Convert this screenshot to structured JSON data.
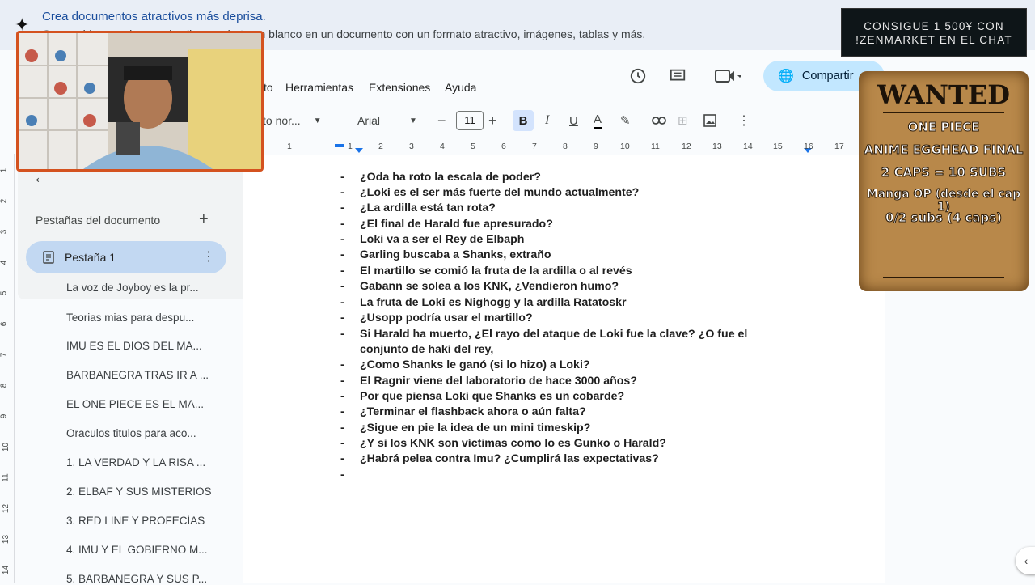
{
  "banner": {
    "title": "Crea documentos atractivos más deprisa.",
    "description": "Genera bloques de un solo clic: convierte en blanco en un documento con un formato atractivo, imágenes, tablas y más."
  },
  "menu": {
    "items": [
      "to",
      "Herramientas",
      "Extensiones",
      "Ayuda"
    ]
  },
  "header": {
    "share_label": "Compartir"
  },
  "toolbar": {
    "style_value": "xto nor...",
    "font_value": "Arial",
    "font_size": "11",
    "bold": "B",
    "italic": "I",
    "underline": "U",
    "text_color": "A"
  },
  "ruler": {
    "ticks": [
      "1",
      "1",
      "2",
      "3",
      "4",
      "5",
      "6",
      "7",
      "8",
      "9",
      "10",
      "11",
      "12",
      "13",
      "14",
      "15",
      "16",
      "17"
    ]
  },
  "vruler": {
    "ticks": [
      "1",
      "2",
      "3",
      "4",
      "5",
      "6",
      "7",
      "8",
      "9",
      "10",
      "11",
      "12",
      "13",
      "14"
    ]
  },
  "sidebar": {
    "heading": "Pestañas del documento",
    "active_tab": "Pestaña 1",
    "outline": [
      "La voz de Joyboy es la pr...",
      "Teorias mias para despu...",
      "IMU ES EL DIOS DEL MA...",
      "BARBANEGRA TRAS IR A ...",
      "EL ONE PIECE ES EL MA...",
      "Oraculos titulos para aco...",
      "1. LA VERDAD Y LA RISA ...",
      "2. ELBAF Y SUS MISTERIOS",
      "3. RED LINE Y PROFECÍAS",
      "4. IMU Y EL GOBIERNO M...",
      "5. BARBANEGRA Y SUS P..."
    ]
  },
  "document": {
    "lines": [
      "¿Oda ha roto la escala de poder?",
      "¿Loki es el ser más fuerte del mundo actualmente?",
      "¿La ardilla está tan rota?",
      "¿El final de Harald fue apresurado?",
      "Loki va a ser el Rey de Elbaph",
      "Garling buscaba a Shanks, extraño",
      "El martillo se comió la fruta de la ardilla o al revés",
      "Gabann se solea a los KNK, ¿Vendieron humo?",
      "La fruta de Loki es Nighogg y la ardilla Ratatoskr",
      "¿Usopp podría usar el martillo?",
      "Si Harald ha muerto, ¿El rayo del ataque de Loki fue la clave? ¿O fue el",
      "conjunto de haki del rey,",
      "¿Como Shanks le ganó (si lo hizo) a Loki?",
      "El Ragnir viene del laboratorio de hace 3000 años?",
      "Por que piensa Loki que Shanks es un cobarde?",
      "¿Terminar el flashback ahora o aún falta?",
      "¿Sigue en pie la idea de un mini timeskip?",
      "¿Y si los KNK son víctimas como lo es Gunko o Harald?",
      "¿Habrá pelea contra Imu? ¿Cumplirá las expectativas?",
      ""
    ],
    "bullet": "-"
  },
  "overlay": {
    "promo_line1": "CONSIGUE 1 500¥ CON",
    "promo_line2": "!ZENMARKET EN EL CHAT",
    "wanted_title": "WANTED",
    "wanted_lines": [
      "ONE PIECE",
      "ANIME EGGHEAD FINAL",
      "2 CAPS = 10 SUBS",
      "Manga OP (desde el cap 1)",
      "0/2 subs (4 caps)"
    ]
  },
  "colors": {
    "accent": "#c2e7ff",
    "banner": "#e9eef6",
    "active_tab": "#c2d8f2",
    "webcam_border": "#d4521f"
  }
}
